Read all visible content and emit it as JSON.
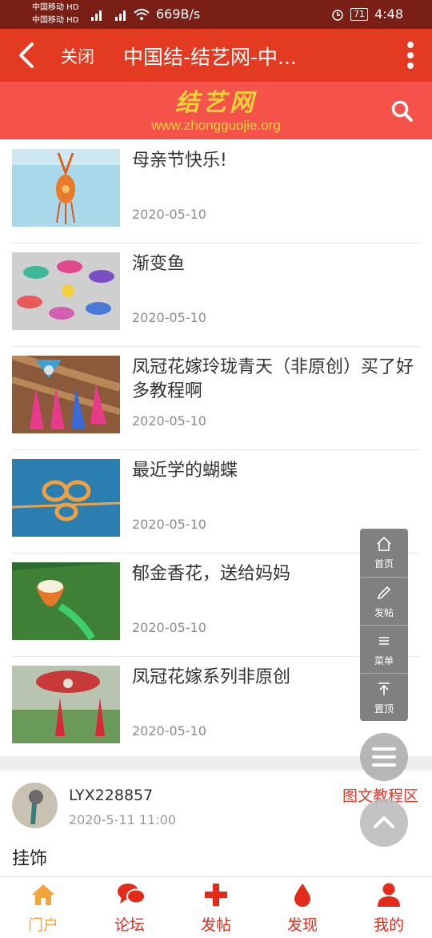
{
  "status_bar": {
    "carrier1": "中国移动 HD",
    "carrier2": "中国移动 HD",
    "speed": "669B/s",
    "battery": "71",
    "time": "4:48"
  },
  "title_bar": {
    "close_label": "关闭",
    "title": "中国结-结艺网-中..."
  },
  "banner": {
    "logo_text": "结艺网",
    "logo_url": "www.zhongguojie.org"
  },
  "articles": [
    {
      "title": "母亲节快乐!",
      "date": "2020-05-10"
    },
    {
      "title": "渐变鱼",
      "date": "2020-05-10"
    },
    {
      "title": "凤冠花嫁玲珑青天（非原创）买了好多教程啊",
      "date": "2020-05-10"
    },
    {
      "title": "最近学的蝴蝶",
      "date": "2020-05-10"
    },
    {
      "title": "郁金香花，送给妈妈",
      "date": "2020-05-10"
    },
    {
      "title": "凤冠花嫁系列非原创",
      "date": "2020-05-10"
    }
  ],
  "post": {
    "author": "LYX228857",
    "time": "2020-5-11 11:00",
    "content": "挂饰"
  },
  "floating": {
    "home": "首页",
    "post": "发帖",
    "menu": "菜单",
    "top": "置顶",
    "tutorial": "图文教程区"
  },
  "bottom_nav": [
    {
      "label": "门户",
      "icon": "home-icon"
    },
    {
      "label": "论坛",
      "icon": "chat-icon"
    },
    {
      "label": "发帖",
      "icon": "plus-icon"
    },
    {
      "label": "发现",
      "icon": "drop-icon"
    },
    {
      "label": "我的",
      "icon": "user-icon"
    }
  ],
  "colors": {
    "title_bar": "#e33a22",
    "banner": "#f5524a",
    "accent_text": "#e32a1b",
    "active_nav": "#f5a33b"
  }
}
